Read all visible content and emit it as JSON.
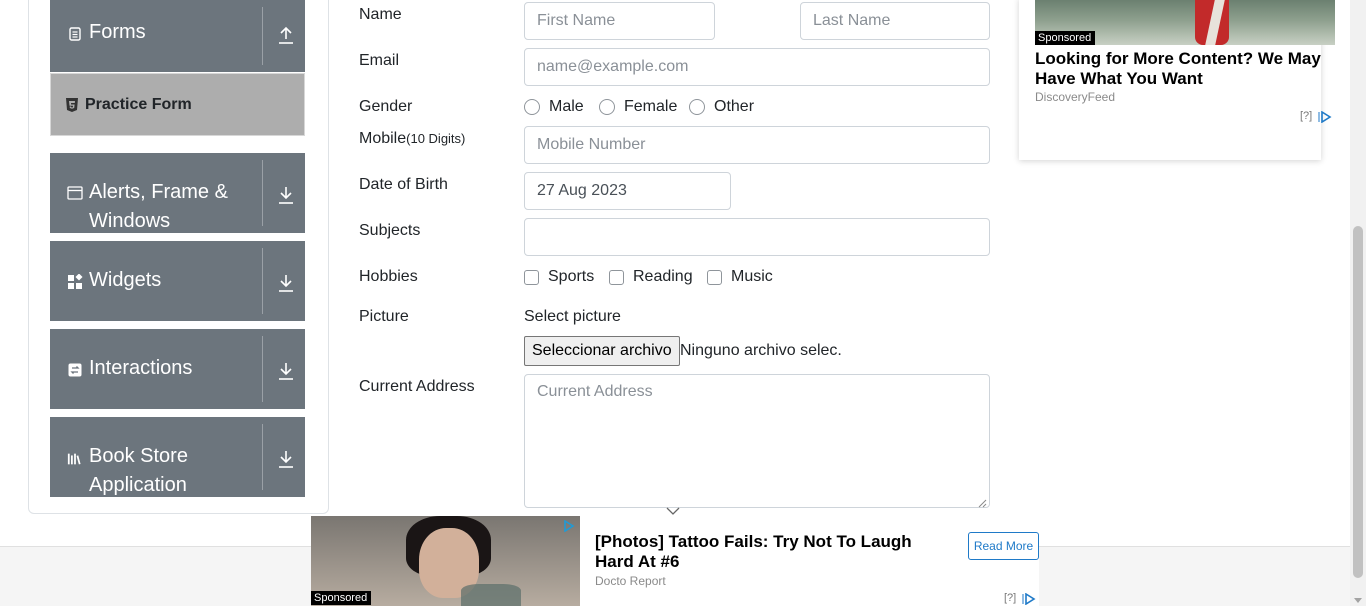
{
  "sidebar": {
    "groups": [
      {
        "label": "Forms",
        "icon": "document-icon",
        "arrow": "chevron-up-icon"
      },
      {
        "label": "Alerts, Frame &",
        "label2": "Windows",
        "icon": "window-icon",
        "arrow": "chevron-down-icon"
      },
      {
        "label": "Widgets",
        "icon": "widgets-icon",
        "arrow": "chevron-down-icon"
      },
      {
        "label": "Interactions",
        "icon": "interactions-icon",
        "arrow": "chevron-down-icon"
      },
      {
        "label": "Book Store",
        "label2": "Application",
        "icon": "books-icon",
        "arrow": "chevron-down-icon"
      }
    ],
    "active_item": {
      "label": "Practice Form",
      "icon": "html5-icon"
    }
  },
  "form": {
    "name_label": "Name",
    "first_name_placeholder": "First Name",
    "last_name_placeholder": "Last Name",
    "email_label": "Email",
    "email_placeholder": "name@example.com",
    "gender_label": "Gender",
    "gender_options": [
      "Male",
      "Female",
      "Other"
    ],
    "mobile_label": "Mobile",
    "mobile_hint": "(10 Digits)",
    "mobile_placeholder": "Mobile Number",
    "dob_label": "Date of Birth",
    "dob_value": "27 Aug 2023",
    "subjects_label": "Subjects",
    "subjects_value": "",
    "hobbies_label": "Hobbies",
    "hobbies_options": [
      "Sports",
      "Reading",
      "Music"
    ],
    "picture_label": "Picture",
    "picture_sub_label": "Select picture",
    "file_button": "Seleccionar archivo",
    "file_status": "Ninguno archivo selec.",
    "address_label": "Current Address",
    "address_placeholder": "Current Address"
  },
  "ad_right": {
    "sponsored": "Sponsored",
    "title": "Looking for More Content? We May Have What You Want",
    "source": "DiscoveryFeed",
    "help": "[?]"
  },
  "ad_bottom": {
    "sponsored": "Sponsored",
    "title": "[Photos] Tattoo Fails: Try Not To Laugh Hard At #6",
    "source": "Docto Report",
    "cta": "Read More",
    "help": "[?]"
  },
  "colors": {
    "group_bg": "#6c757d",
    "active_bg": "#adadad",
    "ad_blue": "#1f7ac8"
  }
}
